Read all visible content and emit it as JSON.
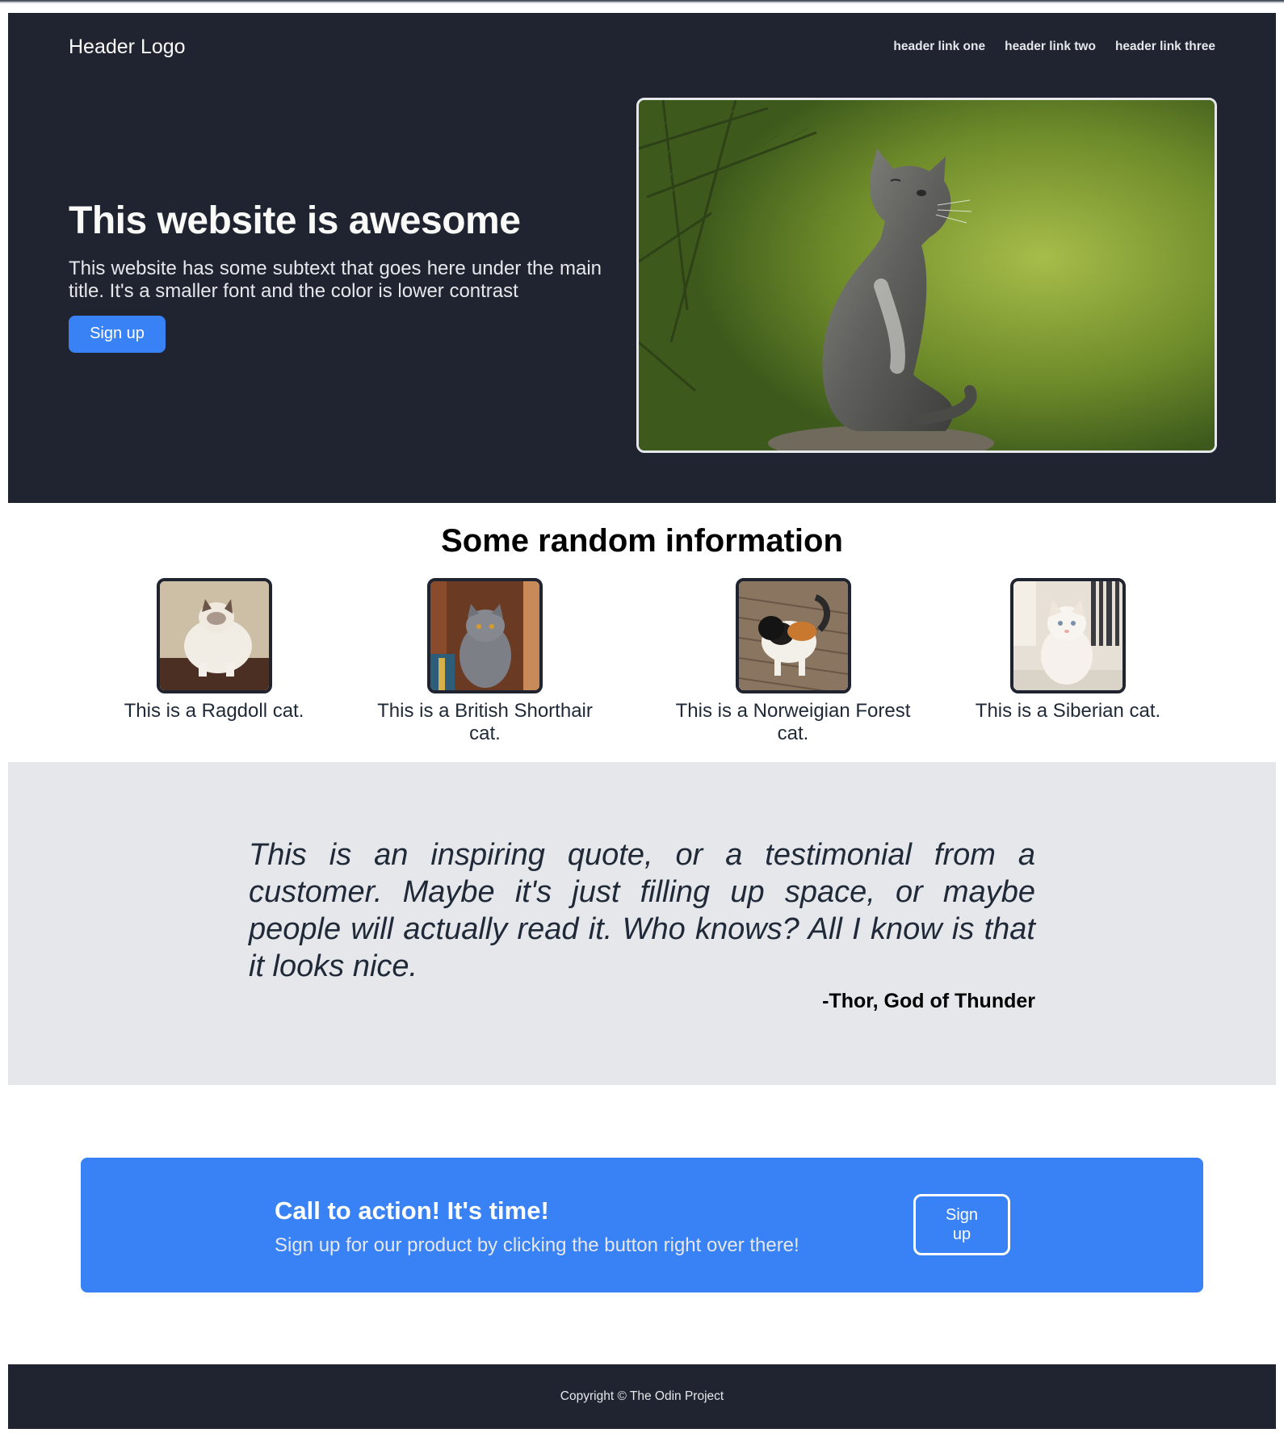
{
  "header": {
    "logo": "Header Logo",
    "links": [
      "header link one",
      "header link two",
      "header link three"
    ]
  },
  "hero": {
    "title": "This website is awesome",
    "subtitle": "This website has some subtext that goes here under the main title. It's a smaller font and the color is lower contrast",
    "button": "Sign up",
    "image_alt": "gray kitten sitting on a rock under pine branches"
  },
  "info": {
    "title": "Some random information",
    "cards": [
      {
        "caption": "This is a Ragdoll cat.",
        "image": "ragdoll-cat"
      },
      {
        "caption": "This is a British Shorthair cat.",
        "image": "british-shorthair-cat"
      },
      {
        "caption": "This is a Norweigian Forest cat.",
        "image": "norwegian-forest-cat"
      },
      {
        "caption": "This is a Siberian cat.",
        "image": "siberian-cat"
      }
    ]
  },
  "quote": {
    "text": "This is an inspiring quote, or a testimonial from a customer. Maybe it's just filling up space, or maybe people will actually read it. Who knows? All I know is that it looks nice.",
    "author": "-Thor, God of Thunder"
  },
  "cta": {
    "title": "Call to action! It's time!",
    "subtitle": "Sign up for our product by clicking the button right over there!",
    "button": "Sign up"
  },
  "footer": {
    "text": "Copyright © The Odin Project"
  },
  "colors": {
    "dark": "#1f2430",
    "accent": "#3882f6",
    "light_gray": "#e5e7eb"
  }
}
